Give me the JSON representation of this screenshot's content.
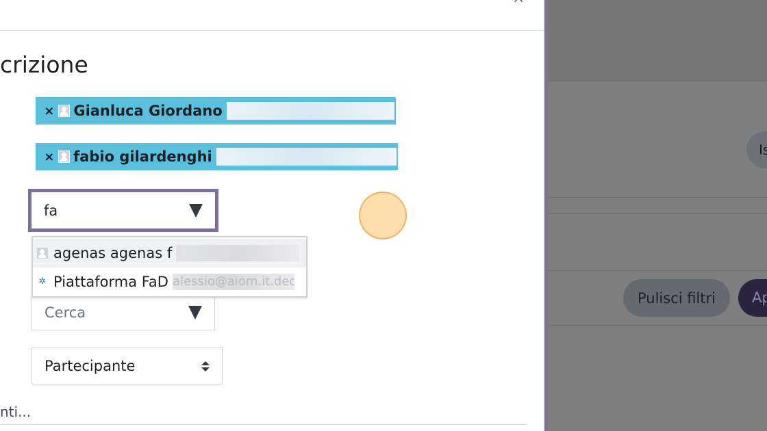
{
  "modal": {
    "close_glyph": "×",
    "title": "crizione",
    "selected_users": [
      {
        "remove": "×",
        "name": "Gianluca Giordano"
      },
      {
        "remove": "×",
        "name": "fabio gilardenghi"
      }
    ],
    "search": {
      "value": "fa"
    },
    "suggestions": [
      {
        "name": "agenas agenas f"
      },
      {
        "name": "Piattaforma FaD",
        "email_fragment": "alessio@aiom.it.ded"
      }
    ],
    "cohort_search": {
      "placeholder": "Cerca"
    },
    "role_select": {
      "value": "Partecipante"
    },
    "more_link": "nti..."
  },
  "background": {
    "pill_label": "Is",
    "clear_filters_label": "Pulisci filtri",
    "apply_label": "Ap"
  },
  "colors": {
    "chip_bg": "#5bc0de",
    "focus_border": "#7c7099",
    "backdrop": "#7f7f7f",
    "cursor_highlight": "#ffd08a"
  }
}
